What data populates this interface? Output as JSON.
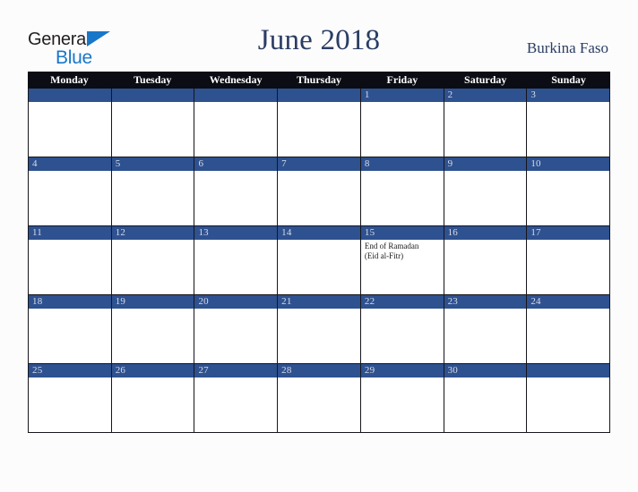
{
  "brand": {
    "name_part1": "General",
    "name_part2": "Blue",
    "triangle_icon": "triangle-icon",
    "color_dark": "#231f20",
    "color_blue": "#1877c9"
  },
  "header": {
    "title": "June 2018",
    "country": "Burkina Faso",
    "title_color": "#2b3d63"
  },
  "calendar": {
    "weekdays": [
      "Monday",
      "Tuesday",
      "Wednesday",
      "Thursday",
      "Friday",
      "Saturday",
      "Sunday"
    ],
    "header_bg": "#0b0c14",
    "day_bar_bg": "#2e5190",
    "day_number_color": "#d9dde6",
    "weeks": [
      [
        {
          "day": ""
        },
        {
          "day": ""
        },
        {
          "day": ""
        },
        {
          "day": ""
        },
        {
          "day": "1"
        },
        {
          "day": "2"
        },
        {
          "day": "3"
        }
      ],
      [
        {
          "day": "4"
        },
        {
          "day": "5"
        },
        {
          "day": "6"
        },
        {
          "day": "7"
        },
        {
          "day": "8"
        },
        {
          "day": "9"
        },
        {
          "day": "10"
        }
      ],
      [
        {
          "day": "11"
        },
        {
          "day": "12"
        },
        {
          "day": "13"
        },
        {
          "day": "14"
        },
        {
          "day": "15",
          "event_line1": "End of Ramadan",
          "event_line2": "(Eid al-Fitr)"
        },
        {
          "day": "16"
        },
        {
          "day": "17"
        }
      ],
      [
        {
          "day": "18"
        },
        {
          "day": "19"
        },
        {
          "day": "20"
        },
        {
          "day": "21"
        },
        {
          "day": "22"
        },
        {
          "day": "23"
        },
        {
          "day": "24"
        }
      ],
      [
        {
          "day": "25"
        },
        {
          "day": "26"
        },
        {
          "day": "27"
        },
        {
          "day": "28"
        },
        {
          "day": "29"
        },
        {
          "day": "30"
        },
        {
          "day": ""
        }
      ]
    ]
  }
}
